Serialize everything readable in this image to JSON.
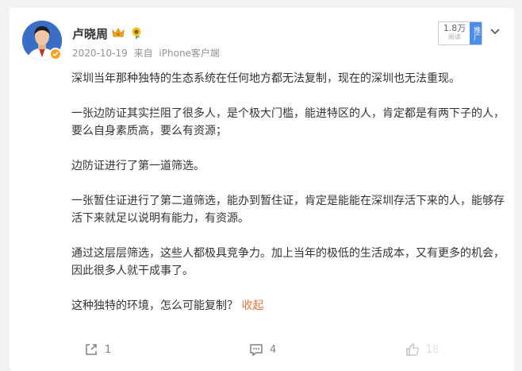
{
  "post": {
    "author": {
      "name": "卢晓周",
      "avatar_icon": "avatar-photo",
      "badges": [
        "crown-badge-icon",
        "sunflower-badge-icon"
      ],
      "verified_color": "#ff9f1c"
    },
    "date": "2020-10-19",
    "source_prefix": "来自",
    "source": "iPhone客户端",
    "views": {
      "count": "1.8万",
      "label": "阅读"
    },
    "promote_label": "推广",
    "paragraphs": [
      "深圳当年那种独特的生态系统在任何地方都无法复制，现在的深圳也无法重现。",
      "一张边防证其实拦阻了很多人，是个极大门槛，能进特区的人，肯定都是有两下子的人，要么自身素质高，要么有资源；",
      "边防证进行了第一道筛选。",
      "一张暂住证进行了第二道筛选，能办到暂住证，肯定是能能在深圳存活下来的人，能够存活下来就足以说明有能力，有资源。",
      "通过这层层筛选，这些人都极具竞争力。加上当年的极低的生活成本，又有更多的机会，因此很多人就干成事了。",
      "这种独特的环境，怎么可能复制？"
    ],
    "collapse_label": "收起",
    "actions": {
      "repost": "1",
      "comment": "4",
      "like": "18"
    },
    "accent_color": "#eb7340"
  }
}
